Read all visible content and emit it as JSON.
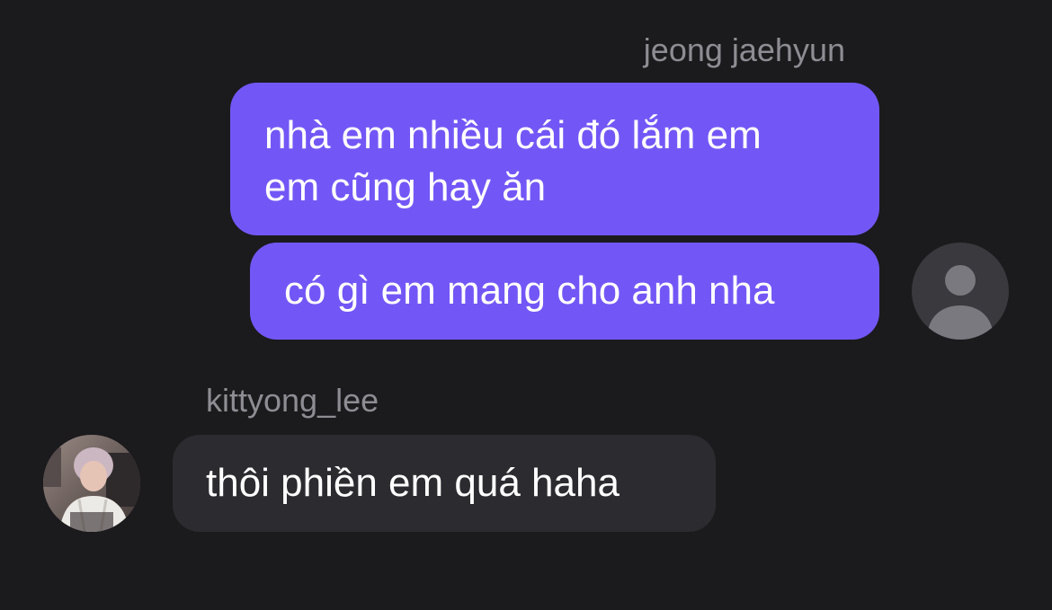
{
  "conversation": {
    "outgoing": {
      "sender_name": "jeong jaehyun",
      "avatar_icon": "default-person-icon",
      "messages": [
        {
          "lines": [
            "nhà em nhiều cái đó lắm em",
            "em cũng hay ăn"
          ]
        },
        {
          "lines": [
            "có gì em mang cho anh nha"
          ]
        }
      ]
    },
    "incoming": {
      "sender_name": "kittyong_lee",
      "avatar_icon": "profile-photo",
      "messages": [
        {
          "lines": [
            "thôi phiền em quá haha"
          ]
        }
      ]
    }
  },
  "colors": {
    "background": "#1b1a1d",
    "outgoing_bubble": "#7357f6",
    "incoming_bubble": "#2c2b30",
    "sender_name": "#8e8d93",
    "message_text": "#ffffff"
  }
}
